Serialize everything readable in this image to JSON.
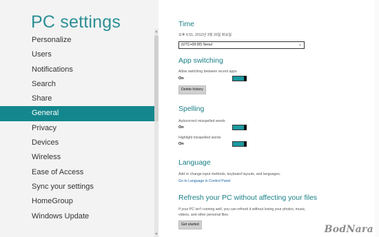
{
  "nav": {
    "title": "PC settings",
    "items": [
      {
        "label": "Personalize"
      },
      {
        "label": "Users"
      },
      {
        "label": "Notifications"
      },
      {
        "label": "Search"
      },
      {
        "label": "Share"
      },
      {
        "label": "General"
      },
      {
        "label": "Privacy"
      },
      {
        "label": "Devices"
      },
      {
        "label": "Wireless"
      },
      {
        "label": "Ease of Access"
      },
      {
        "label": "Sync your settings"
      },
      {
        "label": "HomeGroup"
      },
      {
        "label": "Windows Update"
      }
    ],
    "selected": "General",
    "scroll_up": "▲",
    "scroll_down": "▼"
  },
  "time": {
    "title": "Time",
    "current": "오후 6:51, 2012년 3월 20일 화요일",
    "timezone": "(UTC+09:00) Seoul",
    "chevron": "⌄"
  },
  "app_switching": {
    "title": "App switching",
    "desc": "Allow switching between recent apps",
    "state": "On",
    "button": "Delete history"
  },
  "spelling": {
    "title": "Spelling",
    "autocorrect_label": "Autocorrect misspelled words",
    "autocorrect_state": "On",
    "highlight_label": "Highlight misspelled words",
    "highlight_state": "On"
  },
  "language": {
    "title": "Language",
    "desc": "Add or change input methods, keyboard layouts, and languages.",
    "link": "Go to Language in Control Panel"
  },
  "refresh": {
    "title": "Refresh your PC without affecting your files",
    "desc_line1": "If your PC isn't running well, you can refresh it without losing your photos, music,",
    "desc_line2": "videos, and other personal files.",
    "button": "Get started"
  },
  "watermark": "BodNara",
  "colors": {
    "accent": "#13878d",
    "title": "#2d8f95",
    "toggle_on": "#1a9aa0"
  }
}
